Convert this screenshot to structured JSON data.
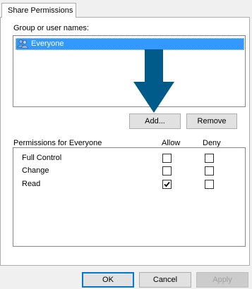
{
  "tab": {
    "title": "Share Permissions"
  },
  "group": {
    "label": "Group or user names:",
    "items": [
      {
        "name": "Everyone",
        "icon": "users-icon",
        "selected": true
      }
    ]
  },
  "buttons": {
    "add": "Add...",
    "remove": "Remove"
  },
  "permissions": {
    "title": "Permissions for Everyone",
    "allow_header": "Allow",
    "deny_header": "Deny",
    "rows": [
      {
        "label": "Full Control",
        "allow": false,
        "deny": false
      },
      {
        "label": "Change",
        "allow": false,
        "deny": false
      },
      {
        "label": "Read",
        "allow": true,
        "deny": false
      }
    ]
  },
  "footer": {
    "ok": "OK",
    "cancel": "Cancel",
    "apply": "Apply"
  },
  "colors": {
    "selection": "#3399ff",
    "arrow": "#005b8a",
    "accent": "#0078d7"
  }
}
